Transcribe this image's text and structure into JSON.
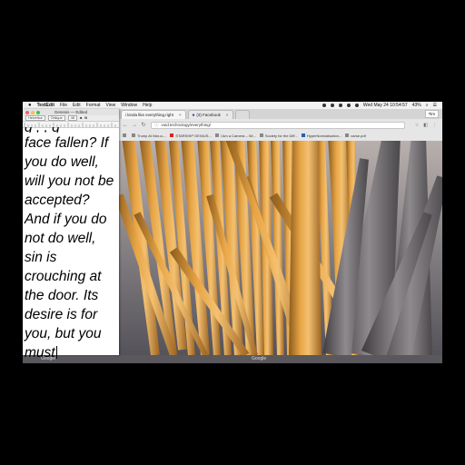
{
  "menubar": {
    "app": "TextEdit",
    "items": [
      "File",
      "Edit",
      "Format",
      "View",
      "Window",
      "Help"
    ],
    "clock": "Wed May 24  10:54:57",
    "battery": "43%"
  },
  "browser": {
    "tabs": [
      {
        "label": "i kinda like everything.right",
        "active": true
      },
      {
        "label": "(3) Facebook",
        "active": false
      }
    ],
    "user": "Tim",
    "url": "void.technology/everything/",
    "bookmarks": [
      {
        "label": "Trump At Mar-a-...",
        "color": "#888888"
      },
      {
        "label": "STARSHIP GENIUS...",
        "color": "#d22222"
      },
      {
        "label": "I Am a Camera – Wi...",
        "color": "#888888"
      },
      {
        "label": "Society for the Diff...",
        "color": "#888888"
      },
      {
        "label": "HyperNormalisation...",
        "color": "#2a5db0"
      },
      {
        "label": "carse.pdf",
        "color": "#888888"
      }
    ]
  },
  "textedit": {
    "title": "Genesis — Edited",
    "font": "Helvetica",
    "style": "Oblique",
    "size": "48",
    "lines": [
      "face fallen? If",
      "you do well,",
      "will you not be",
      "accepted?",
      "And if you do",
      "not do well,",
      "sin is",
      "crouching at",
      "the door. Its",
      "desire is for",
      "you, but you",
      "must"
    ]
  },
  "footer": {
    "left": "Google",
    "right": "Google"
  }
}
